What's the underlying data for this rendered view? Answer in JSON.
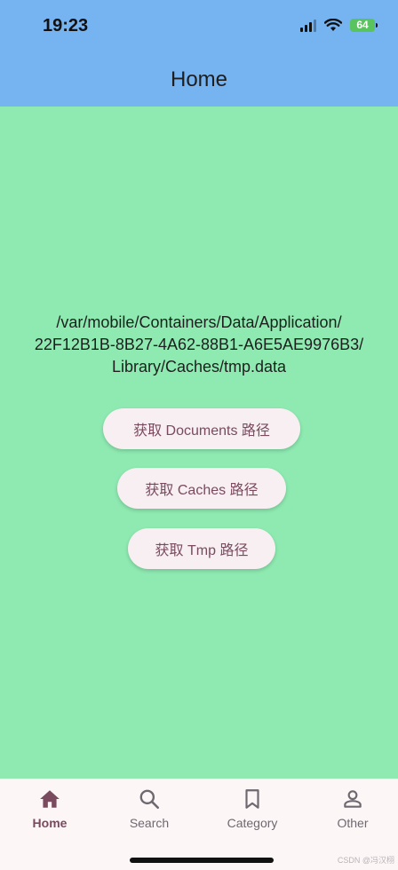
{
  "status_bar": {
    "time": "19:23",
    "battery": "64"
  },
  "app_bar": {
    "title": "Home"
  },
  "main": {
    "path_line1": "/var/mobile/Containers/Data/Application/",
    "path_line2": "22F12B1B-8B27-4A62-88B1-A6E5AE9976B3/",
    "path_line3": "Library/Caches/tmp.data",
    "buttons": {
      "documents": "获取 Documents 路径",
      "caches": "获取 Caches 路径",
      "tmp": "获取 Tmp 路径"
    }
  },
  "bottom_nav": {
    "items": [
      {
        "label": "Home",
        "icon": "home-icon",
        "active": true
      },
      {
        "label": "Search",
        "icon": "search-icon",
        "active": false
      },
      {
        "label": "Category",
        "icon": "bookmark-icon",
        "active": false
      },
      {
        "label": "Other",
        "icon": "person-icon",
        "active": false
      }
    ]
  },
  "watermark": "CSDN @冯汉栩",
  "colors": {
    "app_bar": "#76b3f1",
    "background": "#8eeab1",
    "button_bg": "#f7eff2",
    "accent": "#7a4a5e",
    "nav_bg": "#fdf6f7",
    "battery": "#59c35d"
  }
}
